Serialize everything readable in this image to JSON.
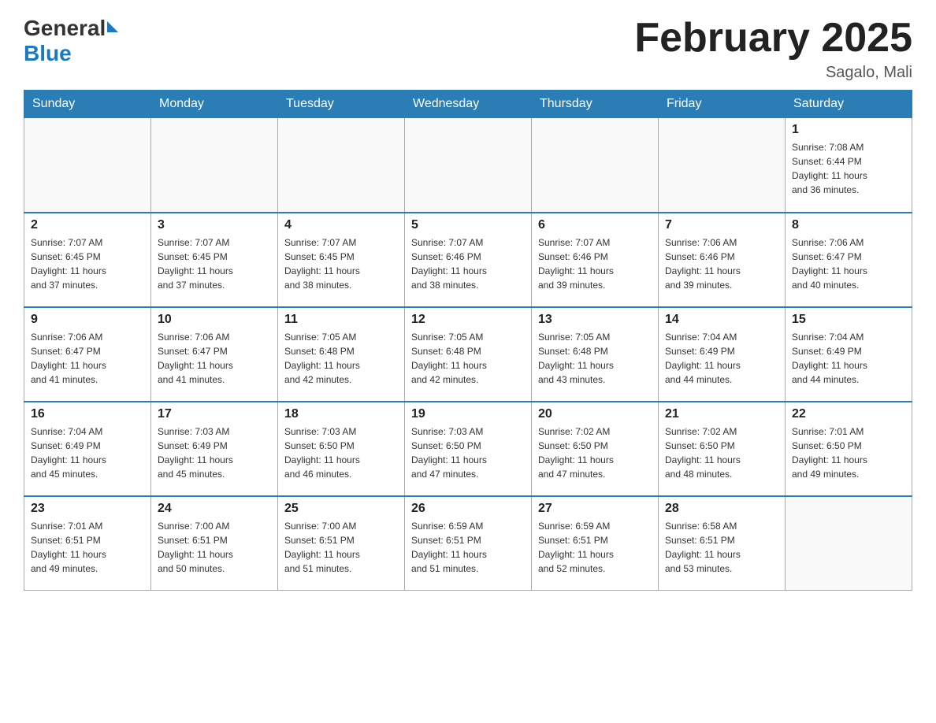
{
  "header": {
    "logo_general": "General",
    "logo_blue": "Blue",
    "month_title": "February 2025",
    "location": "Sagalo, Mali"
  },
  "weekdays": [
    "Sunday",
    "Monday",
    "Tuesday",
    "Wednesday",
    "Thursday",
    "Friday",
    "Saturday"
  ],
  "weeks": [
    [
      {
        "day": "",
        "info": ""
      },
      {
        "day": "",
        "info": ""
      },
      {
        "day": "",
        "info": ""
      },
      {
        "day": "",
        "info": ""
      },
      {
        "day": "",
        "info": ""
      },
      {
        "day": "",
        "info": ""
      },
      {
        "day": "1",
        "info": "Sunrise: 7:08 AM\nSunset: 6:44 PM\nDaylight: 11 hours\nand 36 minutes."
      }
    ],
    [
      {
        "day": "2",
        "info": "Sunrise: 7:07 AM\nSunset: 6:45 PM\nDaylight: 11 hours\nand 37 minutes."
      },
      {
        "day": "3",
        "info": "Sunrise: 7:07 AM\nSunset: 6:45 PM\nDaylight: 11 hours\nand 37 minutes."
      },
      {
        "day": "4",
        "info": "Sunrise: 7:07 AM\nSunset: 6:45 PM\nDaylight: 11 hours\nand 38 minutes."
      },
      {
        "day": "5",
        "info": "Sunrise: 7:07 AM\nSunset: 6:46 PM\nDaylight: 11 hours\nand 38 minutes."
      },
      {
        "day": "6",
        "info": "Sunrise: 7:07 AM\nSunset: 6:46 PM\nDaylight: 11 hours\nand 39 minutes."
      },
      {
        "day": "7",
        "info": "Sunrise: 7:06 AM\nSunset: 6:46 PM\nDaylight: 11 hours\nand 39 minutes."
      },
      {
        "day": "8",
        "info": "Sunrise: 7:06 AM\nSunset: 6:47 PM\nDaylight: 11 hours\nand 40 minutes."
      }
    ],
    [
      {
        "day": "9",
        "info": "Sunrise: 7:06 AM\nSunset: 6:47 PM\nDaylight: 11 hours\nand 41 minutes."
      },
      {
        "day": "10",
        "info": "Sunrise: 7:06 AM\nSunset: 6:47 PM\nDaylight: 11 hours\nand 41 minutes."
      },
      {
        "day": "11",
        "info": "Sunrise: 7:05 AM\nSunset: 6:48 PM\nDaylight: 11 hours\nand 42 minutes."
      },
      {
        "day": "12",
        "info": "Sunrise: 7:05 AM\nSunset: 6:48 PM\nDaylight: 11 hours\nand 42 minutes."
      },
      {
        "day": "13",
        "info": "Sunrise: 7:05 AM\nSunset: 6:48 PM\nDaylight: 11 hours\nand 43 minutes."
      },
      {
        "day": "14",
        "info": "Sunrise: 7:04 AM\nSunset: 6:49 PM\nDaylight: 11 hours\nand 44 minutes."
      },
      {
        "day": "15",
        "info": "Sunrise: 7:04 AM\nSunset: 6:49 PM\nDaylight: 11 hours\nand 44 minutes."
      }
    ],
    [
      {
        "day": "16",
        "info": "Sunrise: 7:04 AM\nSunset: 6:49 PM\nDaylight: 11 hours\nand 45 minutes."
      },
      {
        "day": "17",
        "info": "Sunrise: 7:03 AM\nSunset: 6:49 PM\nDaylight: 11 hours\nand 45 minutes."
      },
      {
        "day": "18",
        "info": "Sunrise: 7:03 AM\nSunset: 6:50 PM\nDaylight: 11 hours\nand 46 minutes."
      },
      {
        "day": "19",
        "info": "Sunrise: 7:03 AM\nSunset: 6:50 PM\nDaylight: 11 hours\nand 47 minutes."
      },
      {
        "day": "20",
        "info": "Sunrise: 7:02 AM\nSunset: 6:50 PM\nDaylight: 11 hours\nand 47 minutes."
      },
      {
        "day": "21",
        "info": "Sunrise: 7:02 AM\nSunset: 6:50 PM\nDaylight: 11 hours\nand 48 minutes."
      },
      {
        "day": "22",
        "info": "Sunrise: 7:01 AM\nSunset: 6:50 PM\nDaylight: 11 hours\nand 49 minutes."
      }
    ],
    [
      {
        "day": "23",
        "info": "Sunrise: 7:01 AM\nSunset: 6:51 PM\nDaylight: 11 hours\nand 49 minutes."
      },
      {
        "day": "24",
        "info": "Sunrise: 7:00 AM\nSunset: 6:51 PM\nDaylight: 11 hours\nand 50 minutes."
      },
      {
        "day": "25",
        "info": "Sunrise: 7:00 AM\nSunset: 6:51 PM\nDaylight: 11 hours\nand 51 minutes."
      },
      {
        "day": "26",
        "info": "Sunrise: 6:59 AM\nSunset: 6:51 PM\nDaylight: 11 hours\nand 51 minutes."
      },
      {
        "day": "27",
        "info": "Sunrise: 6:59 AM\nSunset: 6:51 PM\nDaylight: 11 hours\nand 52 minutes."
      },
      {
        "day": "28",
        "info": "Sunrise: 6:58 AM\nSunset: 6:51 PM\nDaylight: 11 hours\nand 53 minutes."
      },
      {
        "day": "",
        "info": ""
      }
    ]
  ]
}
